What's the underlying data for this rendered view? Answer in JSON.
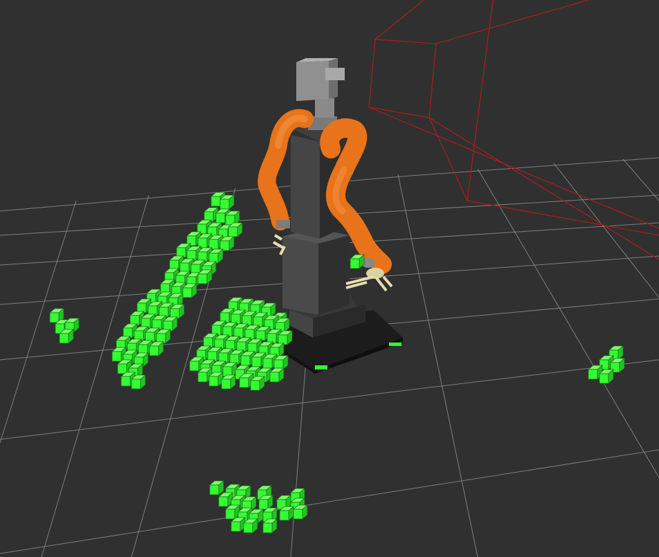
{
  "scene": {
    "background": "#303030",
    "grid": {
      "visible": true,
      "color": "#9a9a9a"
    },
    "camera_frustum": {
      "visible": true,
      "color": "#b01c1c"
    },
    "robot": {
      "arm_color": "#e8731a",
      "body_color": "#3a3a3a",
      "head_color": "#8a8a8a",
      "gripper_color": "#e6ddb0"
    },
    "octomap": {
      "voxel_color": "#33ff33",
      "clusters": [
        "arc-cluster",
        "mound-cluster",
        "small-left-cluster",
        "small-right-cluster",
        "front-cluster",
        "floating-voxel"
      ]
    }
  }
}
